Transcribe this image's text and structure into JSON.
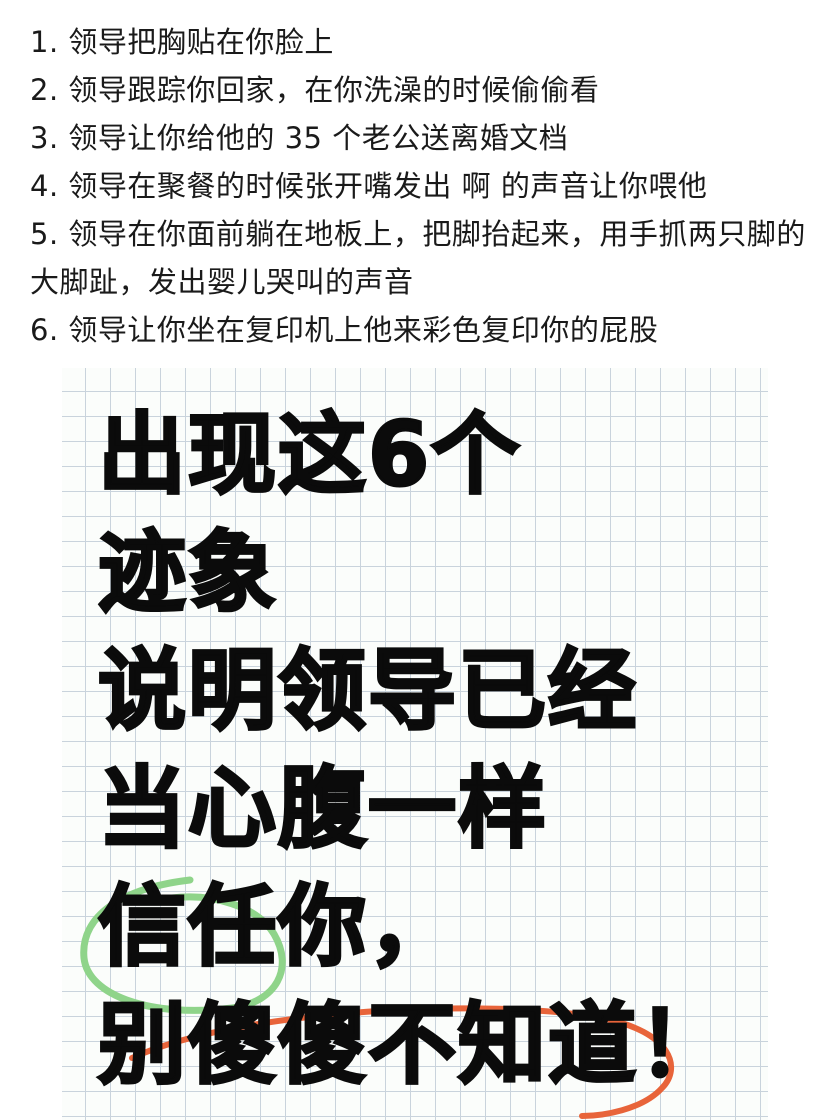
{
  "list": {
    "items": [
      "1. 领导把胸贴在你脸上",
      "2. 领导跟踪你回家，在你洗澡的时候偷偷看",
      "3. 领导让你给他的 35 个老公送离婚文档",
      "4. 领导在聚餐的时候张开嘴发出 啊 的声音让你喂他",
      "5. 领导在你面前躺在地板上，把脚抬起来，用手抓两只脚的大脚趾，发出婴儿哭叫的声音",
      "6. 领导让你坐在复印机上他来彩色复印你的屁股"
    ]
  },
  "poster": {
    "lines": [
      "出现这6个",
      "迹象",
      "说明领导已经",
      "当心腹一样",
      "信任你，",
      "别傻傻不知道！"
    ],
    "highlight_colors": {
      "green_circle": "#8fd48a",
      "orange_circle": "#e8643a"
    },
    "grid_color": "#c9d3dc"
  }
}
